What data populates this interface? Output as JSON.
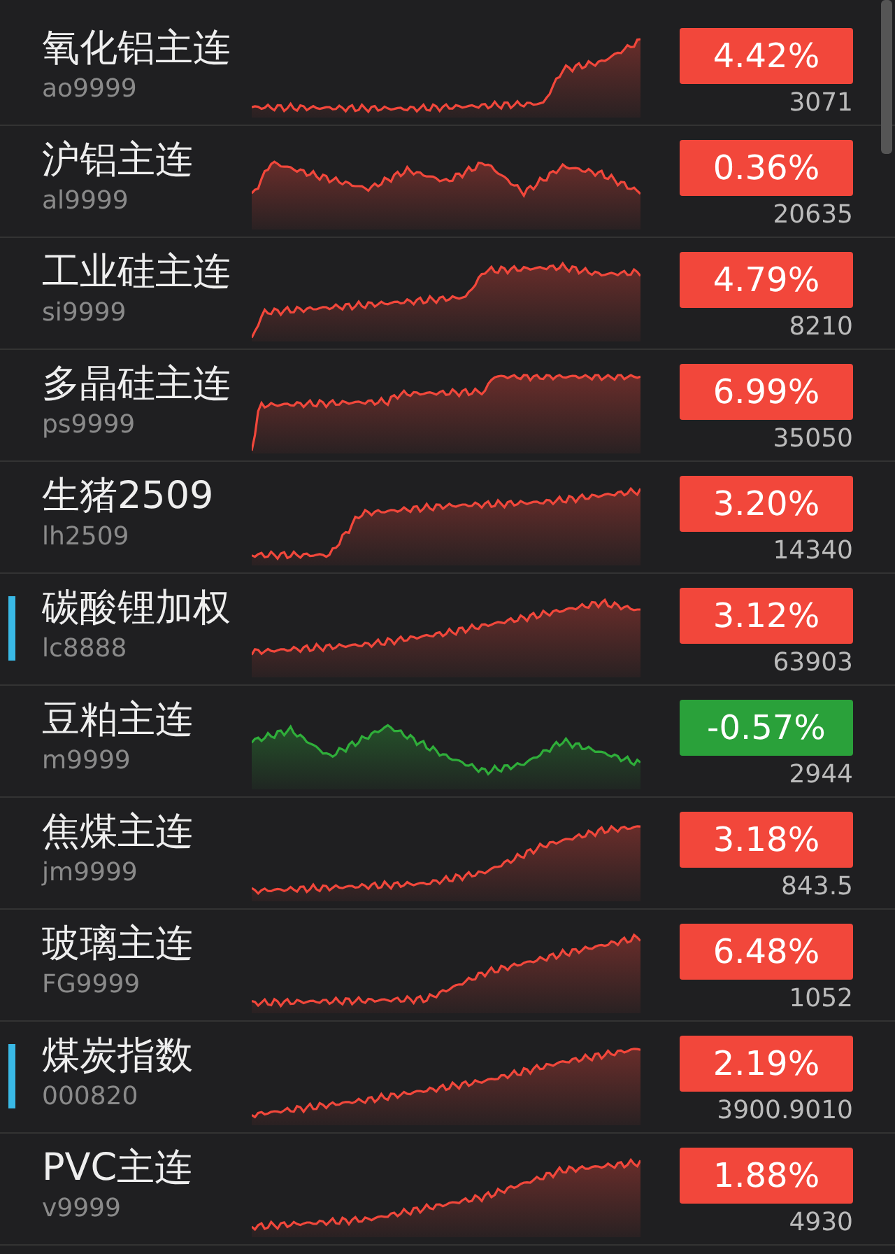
{
  "rows": [
    {
      "name": "氧化铝主连",
      "code": "ao9999",
      "change": "4.42%",
      "volume": "3071",
      "kind": "up",
      "marked": false
    },
    {
      "name": "沪铝主连",
      "code": "al9999",
      "change": "0.36%",
      "volume": "20635",
      "kind": "up",
      "marked": false
    },
    {
      "name": "工业硅主连",
      "code": "si9999",
      "change": "4.79%",
      "volume": "8210",
      "kind": "up",
      "marked": false
    },
    {
      "name": "多晶硅主连",
      "code": "ps9999",
      "change": "6.99%",
      "volume": "35050",
      "kind": "up",
      "marked": false
    },
    {
      "name": "生猪2509",
      "code": "lh2509",
      "change": "3.20%",
      "volume": "14340",
      "kind": "up",
      "marked": false
    },
    {
      "name": "碳酸锂加权",
      "code": "lc8888",
      "change": "3.12%",
      "volume": "63903",
      "kind": "up",
      "marked": true
    },
    {
      "name": "豆粕主连",
      "code": "m9999",
      "change": "-0.57%",
      "volume": "2944",
      "kind": "down",
      "marked": false
    },
    {
      "name": "焦煤主连",
      "code": "jm9999",
      "change": "3.18%",
      "volume": "843.5",
      "kind": "up",
      "marked": false
    },
    {
      "name": "玻璃主连",
      "code": "FG9999",
      "change": "6.48%",
      "volume": "1052",
      "kind": "up",
      "marked": false
    },
    {
      "name": "煤炭指数",
      "code": "000820",
      "change": "2.19%",
      "volume": "3900.9010",
      "kind": "up",
      "marked": true
    },
    {
      "name": "PVC主连",
      "code": "v9999",
      "change": "1.88%",
      "volume": "4930",
      "kind": "up",
      "marked": false
    }
  ]
}
